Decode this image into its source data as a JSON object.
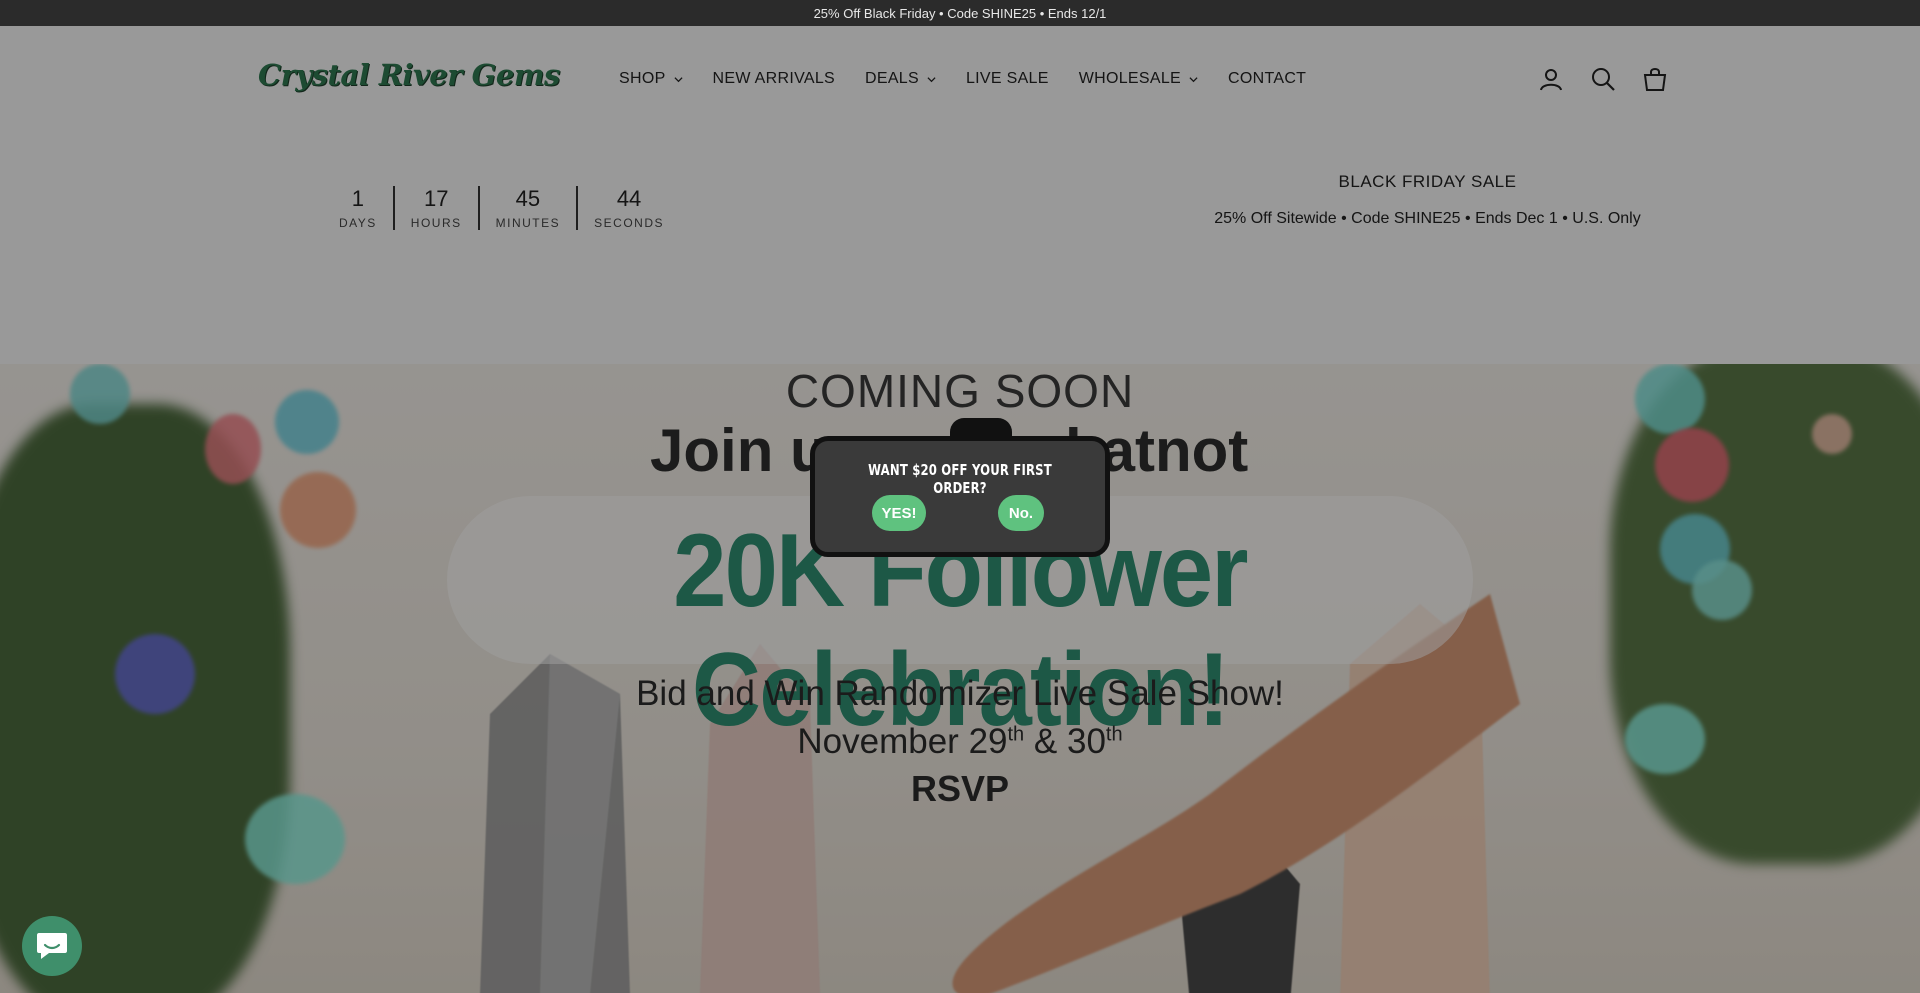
{
  "announcement": {
    "text": "25% Off Black Friday • Code SHINE25 • Ends 12/1"
  },
  "header": {
    "logo_text": "Crystal River Gems",
    "nav": [
      {
        "label": "SHOP",
        "has_dropdown": true
      },
      {
        "label": "NEW ARRIVALS",
        "has_dropdown": false
      },
      {
        "label": "DEALS",
        "has_dropdown": true
      },
      {
        "label": "LIVE SALE",
        "has_dropdown": false
      },
      {
        "label": "WHOLESALE",
        "has_dropdown": true
      },
      {
        "label": "CONTACT",
        "has_dropdown": false
      }
    ],
    "icons": [
      "account-icon",
      "search-icon",
      "cart-icon"
    ]
  },
  "countdown": {
    "units": [
      {
        "value": "1",
        "label": "DAYS"
      },
      {
        "value": "17",
        "label": "HOURS"
      },
      {
        "value": "45",
        "label": "MINUTES"
      },
      {
        "value": "44",
        "label": "SECONDS"
      }
    ]
  },
  "sale": {
    "title": "BLACK FRIDAY SALE",
    "subtitle": "25% Off Sitewide • Code SHINE25 • Ends Dec 1 • U.S. Only"
  },
  "hero": {
    "coming_soon": "COMING SOON",
    "join_left": "Join u",
    "join_right": "hatnot",
    "celebration": "20K Follower Celebration!",
    "line1": "Bid and Win Randomizer Live Sale Show!",
    "line2_a": "November 29",
    "line2_sup1": "th",
    "line2_b": " & 30",
    "line2_sup2": "th",
    "rsvp": "RSVP"
  },
  "popup": {
    "title": "WANT $20 OFF YOUR FIRST ORDER?",
    "yes_label": "YES!",
    "no_label": "No."
  },
  "colors": {
    "accent_green": "#5fc27f",
    "brand_green": "#2f7a52",
    "announce_bg": "#2b2b2b",
    "popup_bg": "#3a3a3a"
  }
}
